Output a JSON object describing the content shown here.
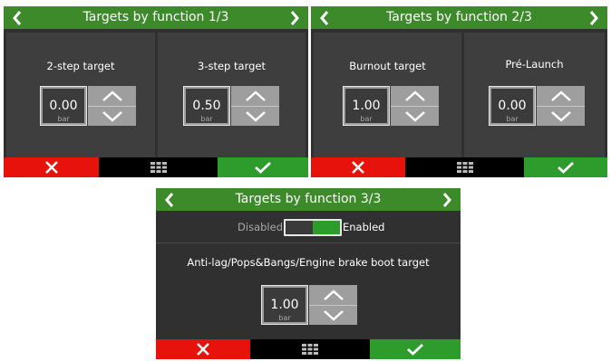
{
  "screens": [
    {
      "title": "Targets by function 1/3",
      "fields": [
        {
          "label": "2-step target",
          "value": "0.00",
          "unit": "bar"
        },
        {
          "label": "3-step target",
          "value": "0.50",
          "unit": "bar"
        }
      ]
    },
    {
      "title": "Targets by function 2/3",
      "fields": [
        {
          "label": "Burnout target",
          "value": "1.00",
          "unit": "bar"
        },
        {
          "label": "Pré-Launch",
          "value": "0.00",
          "unit": "bar"
        }
      ]
    },
    {
      "title": "Targets by function 3/3",
      "toggle": {
        "off_label": "Disabled",
        "on_label": "Enabled",
        "state": "enabled"
      },
      "fields": [
        {
          "label": "Anti-lag/Pops&Bangs/Engine brake boot target",
          "value": "1.00",
          "unit": "bar"
        }
      ]
    }
  ],
  "icons": {
    "prev": "chevron-left-icon",
    "next": "chevron-right-icon",
    "cancel": "close-icon",
    "menu": "grid-menu-icon",
    "confirm": "check-icon",
    "increase": "chevron-up-icon",
    "decrease": "chevron-down-icon"
  },
  "colors": {
    "header": "#3c8a2a",
    "cancel": "#e8120d",
    "confirm": "#2e9c2d",
    "background": "#303030",
    "panel": "#3e3e3e",
    "stepper": "#9e9e9e"
  }
}
